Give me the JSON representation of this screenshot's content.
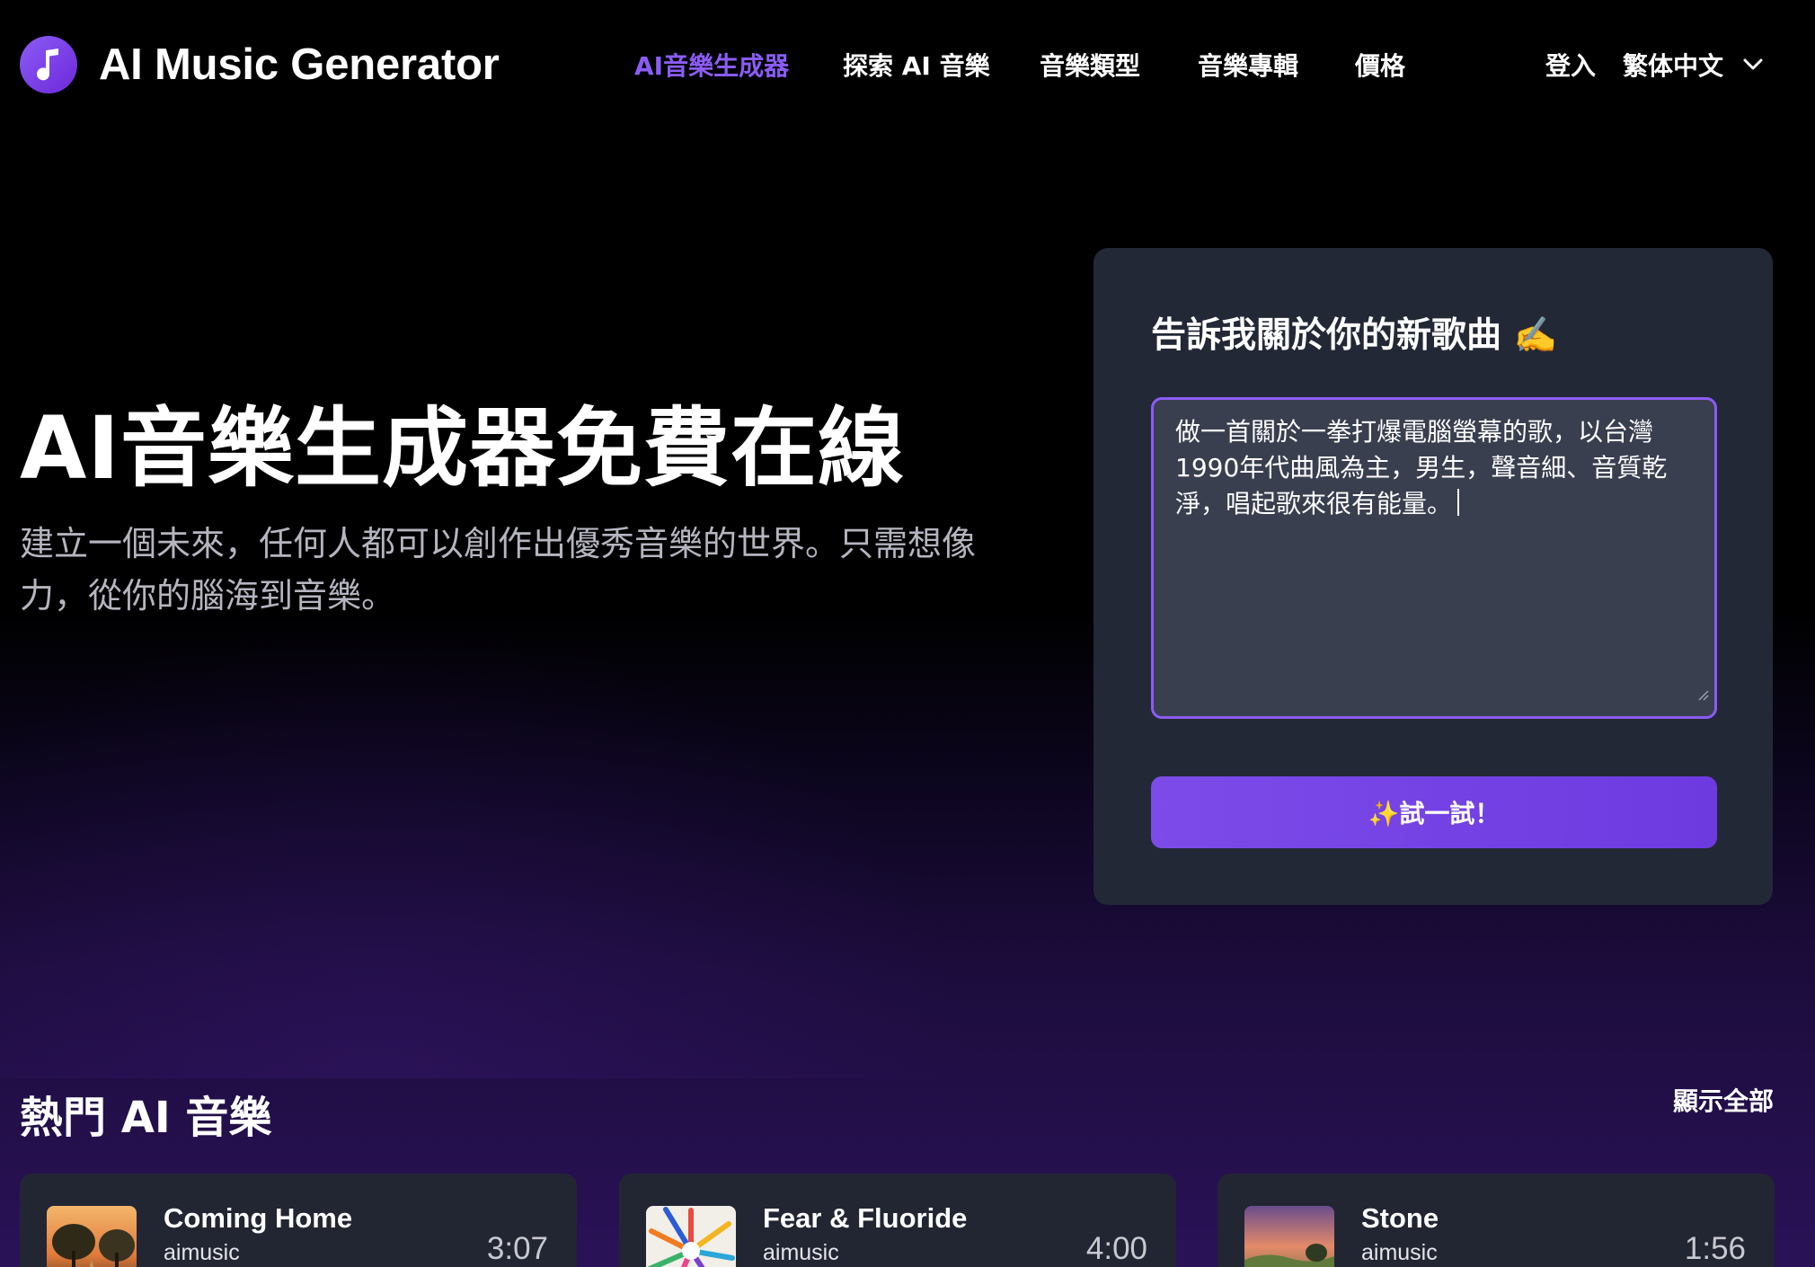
{
  "header": {
    "logo_text": "AI Music Generator",
    "nav": [
      {
        "label": "AI音樂生成器",
        "active": true
      },
      {
        "label": "探索 AI 音樂",
        "active": false
      },
      {
        "label": "音樂類型",
        "active": false
      },
      {
        "label": "音樂專輯",
        "active": false
      },
      {
        "label": "價格",
        "active": false
      }
    ],
    "login_label": "登入",
    "language_label": "繁体中文"
  },
  "hero": {
    "title": "AI音樂生成器免費在線",
    "subtitle": "建立一個未來，任何人都可以創作出優秀音樂的世界。只需想像力，從你的腦海到音樂。"
  },
  "prompt_card": {
    "title": "告訴我關於你的新歌曲 ✍️",
    "prompt_value": "做一首關於一拳打爆電腦螢幕的歌，以台灣1990年代曲風為主，男生，聲音細、音質乾淨，唱起歌來很有能量。",
    "button_label": "✨試一試！"
  },
  "popular": {
    "title": "熱門 AI 音樂",
    "show_all_label": "顯示全部",
    "songs": [
      {
        "title": "Coming Home",
        "artist": "aimusic",
        "duration": "3:07"
      },
      {
        "title": "Fear & Fluoride",
        "artist": "aimusic",
        "duration": "4:00"
      },
      {
        "title": "Stone",
        "artist": "aimusic",
        "duration": "1:56"
      }
    ]
  },
  "colors": {
    "accent": "#8b5cf6",
    "card_bg": "#232836",
    "input_bg": "#3a3f4f",
    "button_bg": "#7c4be8"
  },
  "icons": {
    "logo": "music-note-icon",
    "language": "chevron-down-icon"
  }
}
